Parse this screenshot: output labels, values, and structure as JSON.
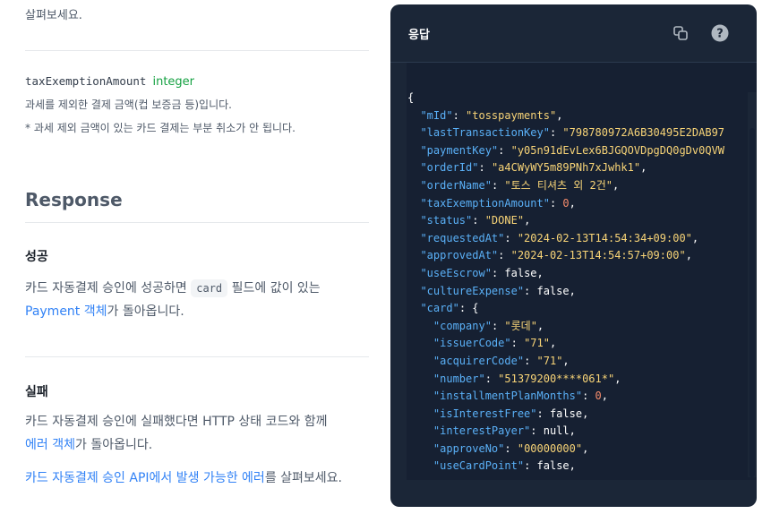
{
  "top_text": "살펴보세요.",
  "param": {
    "name": "taxExemptionAmount",
    "type": "integer",
    "desc1": "과세를 제외한 결제 금액(컵 보증금 등)입니다.",
    "desc2": "* 과세 제외 금액이 있는 카드 결제는 부분 취소가 안 됩니다."
  },
  "response": {
    "heading": "Response",
    "success": {
      "title": "성공",
      "text_before_chip": "카드 자동결제 승인에 성공하면 ",
      "chip": "card",
      "text_after_chip": " 필드에 값이 있는",
      "link": "Payment 객체",
      "text_end": "가 돌아옵니다."
    },
    "failure": {
      "title": "실패",
      "text1": "카드 자동결제 승인에 실패했다면 HTTP 상태 코드와 함께",
      "link1": "에러 객체",
      "text1_end": "가 돌아옵니다.",
      "link2": "카드 자동결제 승인 API에서 발생 가능한 에러",
      "text2_end": "를 살펴보세요."
    }
  },
  "panel": {
    "title": "응답",
    "icons": {
      "copy": "copy-icon",
      "help": "help-icon"
    },
    "colors": {
      "bg": "#1b2637",
      "key": "#5ab0f7",
      "string": "#f8d477",
      "number": "#f78c6c"
    },
    "lines": [
      {
        "indent": 0,
        "punct": "{"
      },
      {
        "indent": 1,
        "key": "mId",
        "value": "\"tosspayments\"",
        "vt": "s",
        "comma": true
      },
      {
        "indent": 1,
        "key": "lastTransactionKey",
        "value": "\"798780972A6B30495E2DAB97",
        "vt": "s",
        "comma": false
      },
      {
        "indent": 1,
        "key": "paymentKey",
        "value": "\"y05n91dEvLex6BJGQOVDpgDQ0gDv0QVW",
        "vt": "s",
        "comma": false
      },
      {
        "indent": 1,
        "key": "orderId",
        "value": "\"a4CWyWY5m89PNh7xJwhk1\"",
        "vt": "s",
        "comma": true
      },
      {
        "indent": 1,
        "key": "orderName",
        "value": "\"토스 티셔츠 외 2건\"",
        "vt": "s",
        "comma": true
      },
      {
        "indent": 1,
        "key": "taxExemptionAmount",
        "value": "0",
        "vt": "n",
        "comma": true
      },
      {
        "indent": 1,
        "key": "status",
        "value": "\"DONE\"",
        "vt": "s",
        "comma": true
      },
      {
        "indent": 1,
        "key": "requestedAt",
        "value": "\"2024-02-13T14:54:34+09:00\"",
        "vt": "s",
        "comma": true
      },
      {
        "indent": 1,
        "key": "approvedAt",
        "value": "\"2024-02-13T14:54:57+09:00\"",
        "vt": "s",
        "comma": true
      },
      {
        "indent": 1,
        "key": "useEscrow",
        "value": "false",
        "vt": "p",
        "comma": true
      },
      {
        "indent": 1,
        "key": "cultureExpense",
        "value": "false",
        "vt": "p",
        "comma": true
      },
      {
        "indent": 1,
        "key": "card",
        "value": "{",
        "vt": "p",
        "comma": false
      },
      {
        "indent": 2,
        "key": "company",
        "value": "\"롯데\"",
        "vt": "s",
        "comma": true
      },
      {
        "indent": 2,
        "key": "issuerCode",
        "value": "\"71\"",
        "vt": "s",
        "comma": true
      },
      {
        "indent": 2,
        "key": "acquirerCode",
        "value": "\"71\"",
        "vt": "s",
        "comma": true
      },
      {
        "indent": 2,
        "key": "number",
        "value": "\"51379200****061*\"",
        "vt": "s",
        "comma": true
      },
      {
        "indent": 2,
        "key": "installmentPlanMonths",
        "value": "0",
        "vt": "n",
        "comma": true
      },
      {
        "indent": 2,
        "key": "isInterestFree",
        "value": "false",
        "vt": "p",
        "comma": true
      },
      {
        "indent": 2,
        "key": "interestPayer",
        "value": "null",
        "vt": "p",
        "comma": true
      },
      {
        "indent": 2,
        "key": "approveNo",
        "value": "\"00000000\"",
        "vt": "s",
        "comma": true
      },
      {
        "indent": 2,
        "key": "useCardPoint",
        "value": "false",
        "vt": "p",
        "comma": true
      }
    ]
  }
}
